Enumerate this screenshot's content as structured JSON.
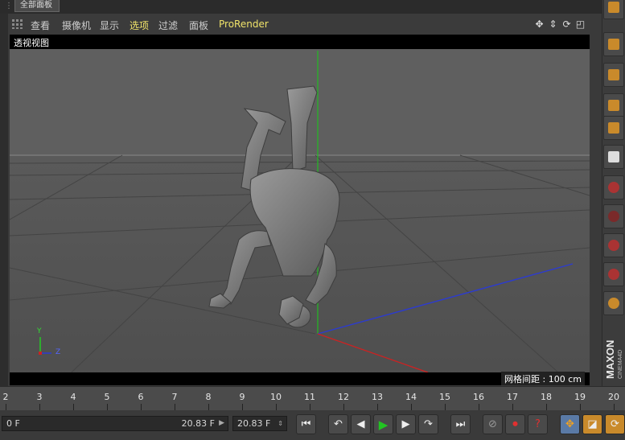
{
  "top_panel": {
    "tab_label": "全部面板"
  },
  "menu": {
    "items": [
      {
        "label": "查看",
        "active": false
      },
      {
        "label": "摄像机",
        "active": false
      },
      {
        "label": "显示",
        "active": false
      },
      {
        "label": "选项",
        "active": true
      },
      {
        "label": "过滤",
        "active": false
      },
      {
        "label": "面板",
        "active": false
      },
      {
        "label": "ProRender",
        "active": false
      }
    ],
    "nav_icons": [
      "move-view-icon",
      "dolly-view-icon",
      "rotate-view-icon",
      "maximize-view-icon"
    ]
  },
  "viewport": {
    "title": "透视视图",
    "grid_spacing": "网格间距 : 100 cm",
    "axis_labels": {
      "y": "Y",
      "z": "Z"
    }
  },
  "timeline": {
    "ticks": [
      "2",
      "3",
      "4",
      "5",
      "6",
      "7",
      "8",
      "9",
      "10",
      "11",
      "12",
      "13",
      "14",
      "15",
      "16",
      "17",
      "18",
      "19",
      "20"
    ]
  },
  "transport": {
    "start_field": "0 F",
    "end_field": "20.83 F",
    "current_field": "20.83 F",
    "buttons": [
      {
        "name": "go-to-start-icon",
        "glyph": "⏮"
      },
      {
        "name": "previous-keyframe-icon",
        "glyph": "◀"
      },
      {
        "name": "previous-frame-icon",
        "glyph": "◁"
      },
      {
        "name": "play-icon",
        "glyph": "▶"
      },
      {
        "name": "next-frame-icon",
        "glyph": "▷"
      },
      {
        "name": "next-keyframe-icon",
        "glyph": "▶"
      },
      {
        "name": "go-to-end-icon",
        "glyph": "⏭"
      }
    ],
    "record_buttons": [
      "no-record-icon",
      "record-keys-icon",
      "help-record-icon"
    ],
    "tool_buttons": [
      "move-tool-icon",
      "scale-tool-icon",
      "rotate-tool-icon"
    ]
  },
  "right_toolbar": {
    "logo_text": "MAXON",
    "logo_subtext": "CINEMA4D",
    "buttons": [
      "cube-icon",
      "cube-icon",
      "cube-icon",
      "cube-icon",
      "axis-icon",
      "gradient-icon",
      "deformer-icon",
      "deformer-icon",
      "deformer-icon",
      "deformer-icon",
      "deformer-icon"
    ]
  },
  "colors": {
    "viewport_bg": "#5f5f5f",
    "active_menu": "#f0e36a",
    "axis_x": "#cc2222",
    "axis_y": "#22cc22",
    "axis_z": "#2233cc",
    "play": "#22c422"
  }
}
